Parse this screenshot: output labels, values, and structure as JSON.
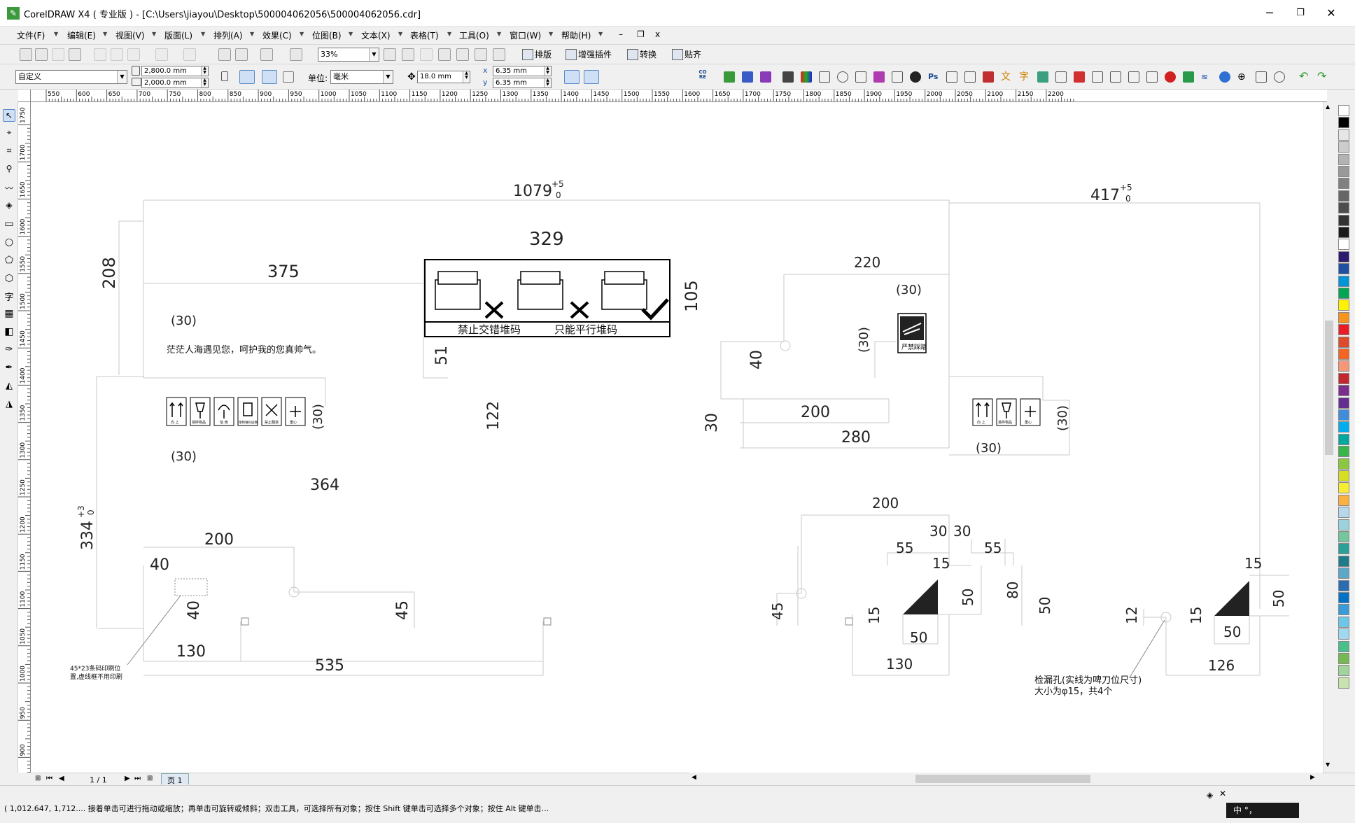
{
  "window": {
    "title": "CorelDRAW X4 ( 专业版 ) - [C:\\Users\\jiayou\\Desktop\\500004062056\\500004062056.cdr]",
    "minimize": "─",
    "restore": "❐",
    "close": "✕"
  },
  "menu": {
    "items": [
      "文件(F)",
      "编辑(E)",
      "视图(V)",
      "版面(L)",
      "排列(A)",
      "效果(C)",
      "位图(B)",
      "文本(X)",
      "表格(T)",
      "工具(O)",
      "窗口(W)",
      "帮助(H)"
    ],
    "doc_controls": [
      "–",
      "❐",
      "x"
    ]
  },
  "toolbar": {
    "zoom_value": "33%",
    "buttons": [
      "排版",
      "增强插件",
      "转换",
      "贴齐"
    ]
  },
  "properties": {
    "page_preset": "自定义",
    "width": "2,800.0 mm",
    "height": "2,000.0 mm",
    "units_label": "单位:",
    "units_value": "毫米",
    "nudge": "18.0 mm",
    "dup_x": "6.35 mm",
    "dup_y": "6.35 mm",
    "labels": {
      "x": "x",
      "y": "y"
    }
  },
  "rulers": {
    "horizontal": [
      "550",
      "600",
      "650",
      "700",
      "750",
      "800",
      "850",
      "900",
      "950",
      "1000",
      "1050",
      "1100",
      "1150",
      "1200",
      "1250",
      "1300",
      "1350",
      "1400",
      "1450",
      "1500",
      "1550",
      "1600",
      "1650",
      "1700",
      "1750",
      "1800",
      "1850",
      "1900",
      "1950",
      "2000",
      "2050",
      "2100",
      "2150",
      "2200"
    ],
    "vertical": [
      "1750",
      "1700",
      "1650",
      "1600",
      "1550",
      "1500",
      "1450",
      "1400",
      "1350",
      "1300",
      "1250",
      "1200",
      "1150",
      "1100",
      "1050",
      "1000",
      "950",
      "900"
    ]
  },
  "drawing": {
    "dims": {
      "d1079": "1079",
      "d417": "417",
      "tol_plus5": "+5",
      "tol_0": "0",
      "tol_plus3": "+3",
      "d329": "329",
      "d375": "375",
      "d208": "208",
      "d105": "105",
      "d220": "220",
      "d51": "51",
      "d122": "122",
      "d40a": "40",
      "d30a": "30",
      "d200a": "200",
      "d280": "280",
      "d364": "364",
      "d334": "334",
      "d200b": "200",
      "d40b": "40",
      "d40c": "40",
      "d45a": "45",
      "d130a": "130",
      "d535": "535",
      "d200c": "200",
      "d30b": "30",
      "d30c": "30",
      "d55a": "55",
      "d55b": "55",
      "d15a": "15",
      "d50a": "50",
      "d80": "80",
      "d50b": "50",
      "d45b": "45",
      "d15b": "15",
      "d50c": "50",
      "d130b": "130",
      "d15c": "15",
      "d50d": "50",
      "d12": "12",
      "d15d": "15",
      "d50e": "50",
      "d126": "126"
    },
    "paren30": "(30)",
    "slogan": "茫茫人海遇见您，呵护我的您真帅气。",
    "stack_text_1": "禁止交错堆码",
    "stack_text_2": "只能平行堆码",
    "fragile_label": "严禁踩踏",
    "barcode_note_1": "45*23条码印刷位",
    "barcode_note_2": "置,虚线框不用印刷",
    "hole_note_1": "检漏孔(实线为啤刀位尺寸)",
    "hole_note_2": "大小为φ15，共4个",
    "icon_labels": [
      "向 上",
      "易碎物品",
      "怕 雨",
      "限制堆码层数",
      "禁止翻滚",
      "重心"
    ],
    "icon_labels_right": [
      "向 上",
      "易碎物品",
      "重心"
    ]
  },
  "pages": {
    "counter": "1 / 1",
    "tab": "页 1"
  },
  "status": {
    "text": "( 1,012.647, 1,712....   接着单击可进行拖动或缩放；再单击可旋转或倾斜；双击工具，可选择所有对象；按住 Shift 键单击可选择多个对象；按住 Alt 键单击...",
    "ime": "中 °，"
  },
  "palette_colors": [
    "#ffffff",
    "#000000",
    "#e6e6e6",
    "#cccccc",
    "#b3b3b3",
    "#999999",
    "#808080",
    "#666666",
    "#4d4d4d",
    "#333333",
    "#1a1a1a",
    "#ffffff",
    "#2e1a6e",
    "#1f4fa3",
    "#0095d9",
    "#00a651",
    "#fff200",
    "#f7941d",
    "#ed1c24",
    "#e04a2c",
    "#f26522",
    "#f7977a",
    "#c1272d",
    "#7b2e8e",
    "#662d91",
    "#3f8ddb",
    "#00aeef",
    "#00a99d",
    "#39b54a",
    "#8dc63f",
    "#d7df23",
    "#f9ed32",
    "#fbb040",
    "#b5d9ea",
    "#9ad3de",
    "#74c69d",
    "#2aa198",
    "#1e7b8c",
    "#5aa9c9",
    "#2b6cb0",
    "#0073c6",
    "#3a9bd9",
    "#6ec6e8",
    "#a0d8ef",
    "#49c08b",
    "#76b852",
    "#a3d39c",
    "#c7e3b0"
  ]
}
